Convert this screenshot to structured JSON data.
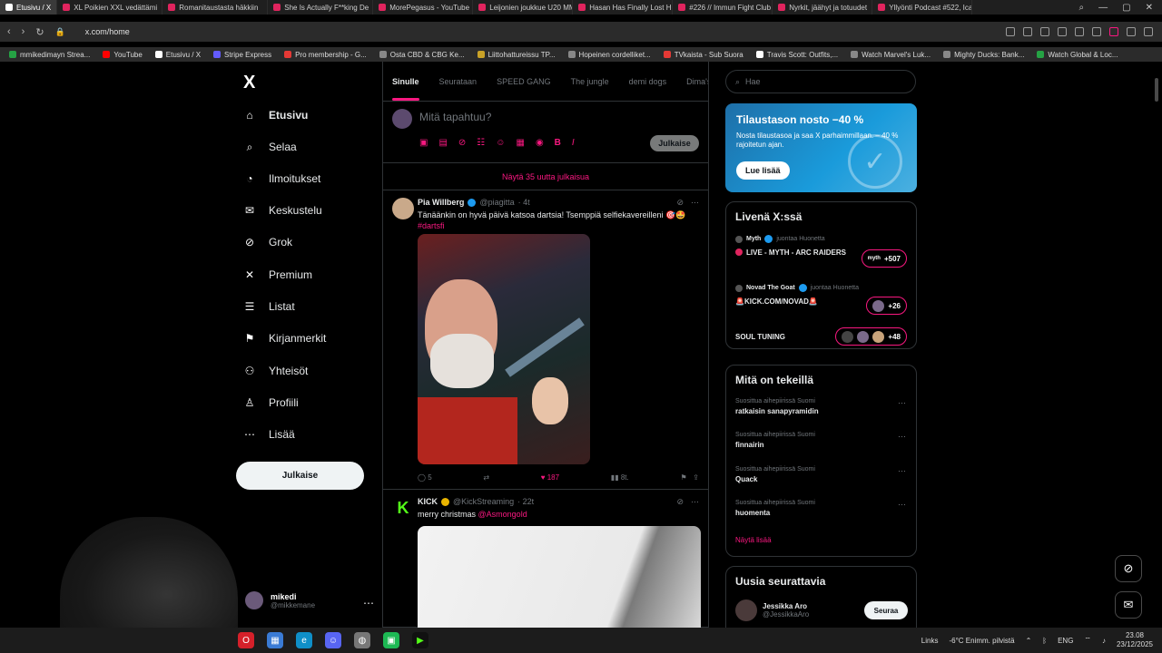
{
  "browser": {
    "tabs": [
      {
        "label": "Etusivu / X",
        "active": true,
        "icon": "x-icon"
      },
      {
        "label": "XL Poikien XXL vedättämi",
        "icon": "youtube-icon"
      },
      {
        "label": "Romanitaustasta häkkiin",
        "icon": "youtube-icon"
      },
      {
        "label": "She Is Actually F**king De",
        "icon": "youtube-icon"
      },
      {
        "label": "MorePegasus - YouTube",
        "icon": "youtube-icon"
      },
      {
        "label": "Leijonien joukkue U20 MM",
        "icon": "youtube-icon"
      },
      {
        "label": "Hasan Has Finally Lost His",
        "icon": "youtube-icon"
      },
      {
        "label": "#226 // Immun Fight Club",
        "icon": "youtube-icon"
      },
      {
        "label": "Nyrkit, jäähyt ja totuudet",
        "icon": "youtube-icon"
      },
      {
        "label": "Yllyönti Podcast #522, Ica",
        "icon": "youtube-icon"
      }
    ],
    "url": "x.com/home",
    "bookmarks": [
      {
        "label": "mmikedimayn Strea...",
        "color": "green"
      },
      {
        "label": "YouTube",
        "color": "youtube"
      },
      {
        "label": "Etusivu / X",
        "color": "x"
      },
      {
        "label": "Stripe Express",
        "color": "grey"
      },
      {
        "label": "Pro membership - G...",
        "color": "grey"
      },
      {
        "label": "Osta CBD & CBG Ke...",
        "color": "grey"
      },
      {
        "label": "Liittohattureissu TP...",
        "color": "grey"
      },
      {
        "label": "Hopeinen cordelliket...",
        "color": "grey"
      },
      {
        "label": "TVkaista - Sub Suora",
        "color": "grey"
      },
      {
        "label": "Travis Scott: Outfits,...",
        "color": "grey"
      },
      {
        "label": "Watch Marvel's Luk...",
        "color": "grey"
      },
      {
        "label": "Mighty Ducks: Bank...",
        "color": "grey"
      },
      {
        "label": "Watch Global & Loc...",
        "color": "green"
      }
    ]
  },
  "sidebar": {
    "logo": "X",
    "items": [
      {
        "label": "Etusivu",
        "icon": "home-icon",
        "glyph": "⌂"
      },
      {
        "label": "Selaa",
        "icon": "search-icon",
        "glyph": "⌕"
      },
      {
        "label": "Ilmoitukset",
        "icon": "bell-icon",
        "glyph": "◔"
      },
      {
        "label": "Keskustelu",
        "icon": "mail-icon",
        "glyph": "✉"
      },
      {
        "label": "Grok",
        "icon": "grok-icon",
        "glyph": "⊘"
      },
      {
        "label": "Premium",
        "icon": "x-premium-icon",
        "glyph": "✕"
      },
      {
        "label": "Listat",
        "icon": "list-icon",
        "glyph": "☰"
      },
      {
        "label": "Kirjanmerkit",
        "icon": "bookmark-icon",
        "glyph": "⚑"
      },
      {
        "label": "Yhteisöt",
        "icon": "communities-icon",
        "glyph": "⚇"
      },
      {
        "label": "Profiili",
        "icon": "profile-icon",
        "glyph": "♙"
      },
      {
        "label": "Lisää",
        "icon": "more-icon",
        "glyph": "⋯"
      }
    ],
    "post_button": "Julkaise",
    "account": {
      "name": "mikedi",
      "handle": "@mikkemane"
    }
  },
  "feed": {
    "tabs": [
      "Sinulle",
      "Seurataan",
      "SPEED GANG",
      "The jungle",
      "demi dogs",
      "Dima's Di"
    ],
    "compose_placeholder": "Mitä tapahtuu?",
    "compose_button": "Julkaise",
    "show_new": "Näytä 35 uutta julkaisua",
    "tweets": [
      {
        "name": "Pia Willberg",
        "handle": "@piagitta",
        "time": "· 4t",
        "text": "Tänäänkin on hyvä päivä katsoa dartsia! Tsemppiä selfiekavereilleni 🎯🤩",
        "tag": "#dartsfi",
        "replies": "5",
        "reposts": "",
        "likes": "187",
        "views": "8t."
      },
      {
        "name": "KICK",
        "handle": "@KickStreaming",
        "time": "· 22t",
        "text": "merry christmas",
        "mention": "@Asmongold"
      }
    ]
  },
  "right": {
    "search_placeholder": "Hae",
    "promo": {
      "title": "Tilaustason nosto −40 %",
      "desc": "Nosta tilaustasoa ja saa X parhaimmillaan. – 40 % rajoitetun ajan.",
      "button": "Lue lisää"
    },
    "live": {
      "title": "Livenä X:ssä",
      "items": [
        {
          "host": "Myth",
          "action": "juontaa Huonetta",
          "title": "LIVE - MYTH - ARC RAIDERS",
          "count": "+507",
          "tag": "myth"
        },
        {
          "host": "Novad The Goat",
          "action": "juontaa Huonetta",
          "title": "🚨KICK.COM/NOVAD🚨",
          "count": "+26"
        },
        {
          "host": "",
          "action": "",
          "title": "SOUL TUNING",
          "count": "+48"
        }
      ]
    },
    "trending": {
      "title": "Mitä on tekeillä",
      "items": [
        {
          "context": "Suosittua aihepiirissä Suomi",
          "name": "ratkaisin sanapyramidin"
        },
        {
          "context": "Suosittua aihepiirissä Suomi",
          "name": "finnairin"
        },
        {
          "context": "Suosittua aihepiirissä Suomi",
          "name": "Quack"
        },
        {
          "context": "Suosittua aihepiirissä Suomi",
          "name": "huomenta"
        }
      ],
      "show_more": "Näytä lisää"
    },
    "follow": {
      "title": "Uusia seurattavia",
      "name": "Jessikka Aro",
      "handle": "@JessikkaAro",
      "button": "Seuraa"
    }
  },
  "taskbar": {
    "links": "Links",
    "weather": "-6°C  Enimm. pilvistä",
    "lang": "ENG",
    "time": "23.08",
    "date": "23/12/2025"
  },
  "colors": {
    "accent": "#f91880",
    "verified": "#1d9bf0",
    "background": "#000000"
  }
}
